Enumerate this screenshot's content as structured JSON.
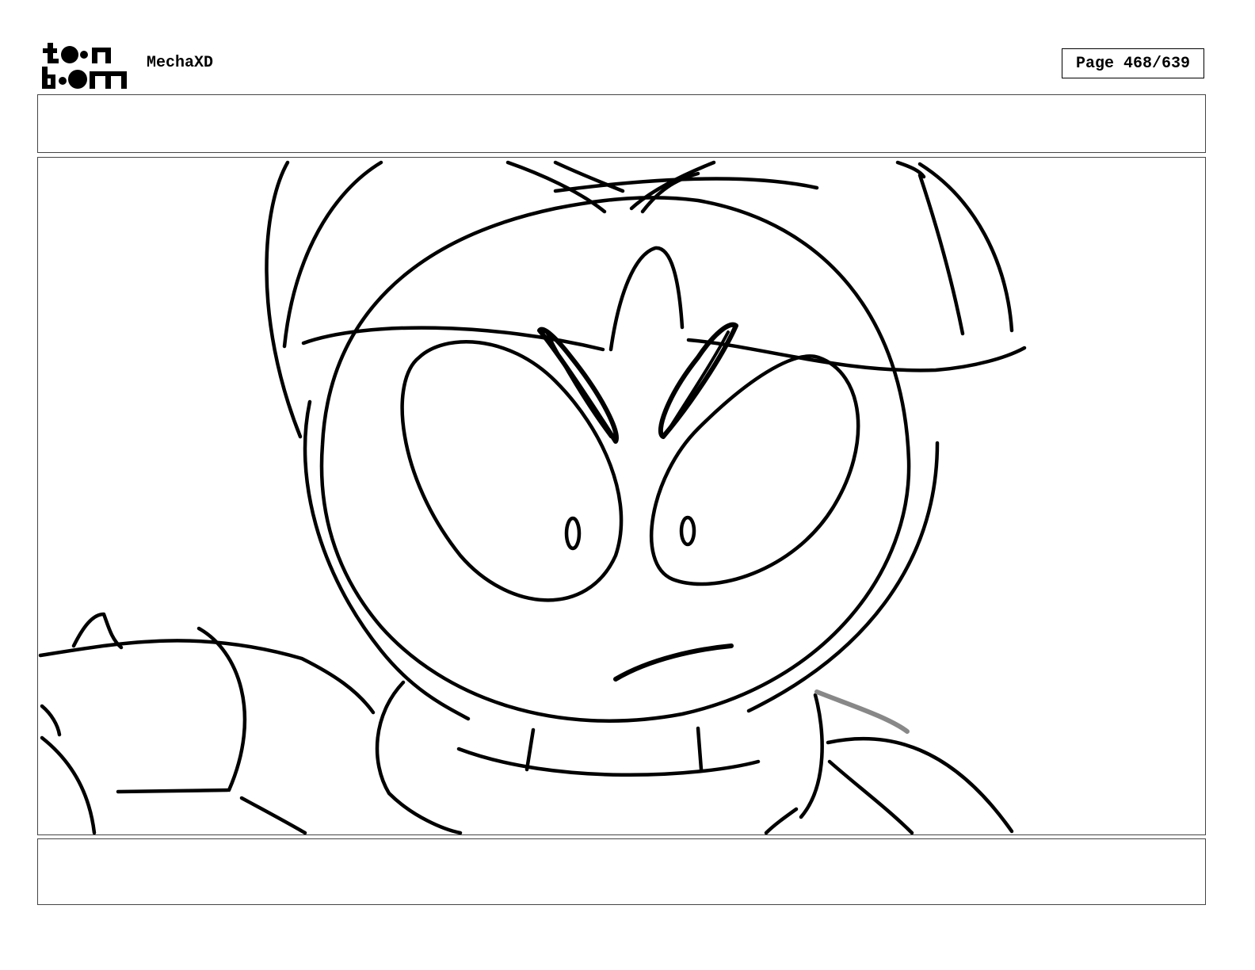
{
  "header": {
    "project_title": "MechaXD",
    "page_label": "Page 468/639"
  },
  "logo": {
    "icon": "toonboom-logo"
  },
  "action_notes": "",
  "dialogue_notes": "",
  "panel": {
    "content": "sketch-drawing"
  }
}
